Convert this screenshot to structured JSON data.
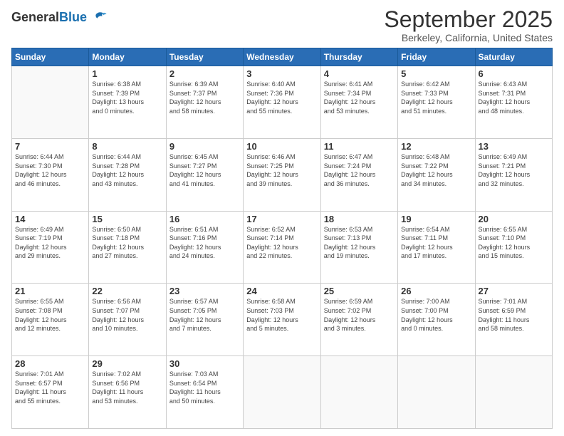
{
  "header": {
    "logo_general": "General",
    "logo_blue": "Blue",
    "month": "September 2025",
    "location": "Berkeley, California, United States"
  },
  "days_of_week": [
    "Sunday",
    "Monday",
    "Tuesday",
    "Wednesday",
    "Thursday",
    "Friday",
    "Saturday"
  ],
  "weeks": [
    [
      {
        "day": "",
        "info": ""
      },
      {
        "day": "1",
        "info": "Sunrise: 6:38 AM\nSunset: 7:39 PM\nDaylight: 13 hours\nand 0 minutes."
      },
      {
        "day": "2",
        "info": "Sunrise: 6:39 AM\nSunset: 7:37 PM\nDaylight: 12 hours\nand 58 minutes."
      },
      {
        "day": "3",
        "info": "Sunrise: 6:40 AM\nSunset: 7:36 PM\nDaylight: 12 hours\nand 55 minutes."
      },
      {
        "day": "4",
        "info": "Sunrise: 6:41 AM\nSunset: 7:34 PM\nDaylight: 12 hours\nand 53 minutes."
      },
      {
        "day": "5",
        "info": "Sunrise: 6:42 AM\nSunset: 7:33 PM\nDaylight: 12 hours\nand 51 minutes."
      },
      {
        "day": "6",
        "info": "Sunrise: 6:43 AM\nSunset: 7:31 PM\nDaylight: 12 hours\nand 48 minutes."
      }
    ],
    [
      {
        "day": "7",
        "info": "Sunrise: 6:44 AM\nSunset: 7:30 PM\nDaylight: 12 hours\nand 46 minutes."
      },
      {
        "day": "8",
        "info": "Sunrise: 6:44 AM\nSunset: 7:28 PM\nDaylight: 12 hours\nand 43 minutes."
      },
      {
        "day": "9",
        "info": "Sunrise: 6:45 AM\nSunset: 7:27 PM\nDaylight: 12 hours\nand 41 minutes."
      },
      {
        "day": "10",
        "info": "Sunrise: 6:46 AM\nSunset: 7:25 PM\nDaylight: 12 hours\nand 39 minutes."
      },
      {
        "day": "11",
        "info": "Sunrise: 6:47 AM\nSunset: 7:24 PM\nDaylight: 12 hours\nand 36 minutes."
      },
      {
        "day": "12",
        "info": "Sunrise: 6:48 AM\nSunset: 7:22 PM\nDaylight: 12 hours\nand 34 minutes."
      },
      {
        "day": "13",
        "info": "Sunrise: 6:49 AM\nSunset: 7:21 PM\nDaylight: 12 hours\nand 32 minutes."
      }
    ],
    [
      {
        "day": "14",
        "info": "Sunrise: 6:49 AM\nSunset: 7:19 PM\nDaylight: 12 hours\nand 29 minutes."
      },
      {
        "day": "15",
        "info": "Sunrise: 6:50 AM\nSunset: 7:18 PM\nDaylight: 12 hours\nand 27 minutes."
      },
      {
        "day": "16",
        "info": "Sunrise: 6:51 AM\nSunset: 7:16 PM\nDaylight: 12 hours\nand 24 minutes."
      },
      {
        "day": "17",
        "info": "Sunrise: 6:52 AM\nSunset: 7:14 PM\nDaylight: 12 hours\nand 22 minutes."
      },
      {
        "day": "18",
        "info": "Sunrise: 6:53 AM\nSunset: 7:13 PM\nDaylight: 12 hours\nand 19 minutes."
      },
      {
        "day": "19",
        "info": "Sunrise: 6:54 AM\nSunset: 7:11 PM\nDaylight: 12 hours\nand 17 minutes."
      },
      {
        "day": "20",
        "info": "Sunrise: 6:55 AM\nSunset: 7:10 PM\nDaylight: 12 hours\nand 15 minutes."
      }
    ],
    [
      {
        "day": "21",
        "info": "Sunrise: 6:55 AM\nSunset: 7:08 PM\nDaylight: 12 hours\nand 12 minutes."
      },
      {
        "day": "22",
        "info": "Sunrise: 6:56 AM\nSunset: 7:07 PM\nDaylight: 12 hours\nand 10 minutes."
      },
      {
        "day": "23",
        "info": "Sunrise: 6:57 AM\nSunset: 7:05 PM\nDaylight: 12 hours\nand 7 minutes."
      },
      {
        "day": "24",
        "info": "Sunrise: 6:58 AM\nSunset: 7:03 PM\nDaylight: 12 hours\nand 5 minutes."
      },
      {
        "day": "25",
        "info": "Sunrise: 6:59 AM\nSunset: 7:02 PM\nDaylight: 12 hours\nand 3 minutes."
      },
      {
        "day": "26",
        "info": "Sunrise: 7:00 AM\nSunset: 7:00 PM\nDaylight: 12 hours\nand 0 minutes."
      },
      {
        "day": "27",
        "info": "Sunrise: 7:01 AM\nSunset: 6:59 PM\nDaylight: 11 hours\nand 58 minutes."
      }
    ],
    [
      {
        "day": "28",
        "info": "Sunrise: 7:01 AM\nSunset: 6:57 PM\nDaylight: 11 hours\nand 55 minutes."
      },
      {
        "day": "29",
        "info": "Sunrise: 7:02 AM\nSunset: 6:56 PM\nDaylight: 11 hours\nand 53 minutes."
      },
      {
        "day": "30",
        "info": "Sunrise: 7:03 AM\nSunset: 6:54 PM\nDaylight: 11 hours\nand 50 minutes."
      },
      {
        "day": "",
        "info": ""
      },
      {
        "day": "",
        "info": ""
      },
      {
        "day": "",
        "info": ""
      },
      {
        "day": "",
        "info": ""
      }
    ]
  ]
}
